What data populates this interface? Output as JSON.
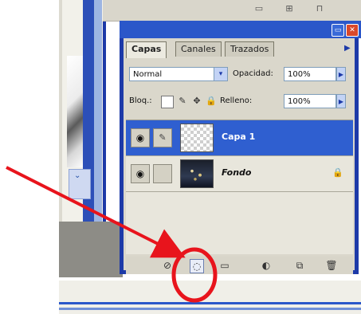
{
  "palette": {
    "tabs": [
      "Capas",
      "Canales",
      "Trazados"
    ],
    "blend_mode": "Normal",
    "opacity_label": "Opacidad:",
    "opacity_value": "100%",
    "lock_label": "Bloq.:",
    "fill_label": "Relleno:",
    "fill_value": "100%"
  },
  "layers": [
    {
      "name": "Capa 1",
      "selected": true,
      "thumbnail": "transparent"
    },
    {
      "name": "Fondo",
      "selected": false,
      "thumbnail": "photo",
      "locked": true
    }
  ],
  "bottom_icons": [
    "link-layers-icon",
    "add-layer-mask-icon",
    "new-group-icon",
    "adjustment-layer-icon",
    "new-layer-icon",
    "trash-icon"
  ],
  "colors": {
    "accent": "#2b57c9",
    "selected_layer": "#2f5fd0",
    "annotation": "#e8141c"
  }
}
